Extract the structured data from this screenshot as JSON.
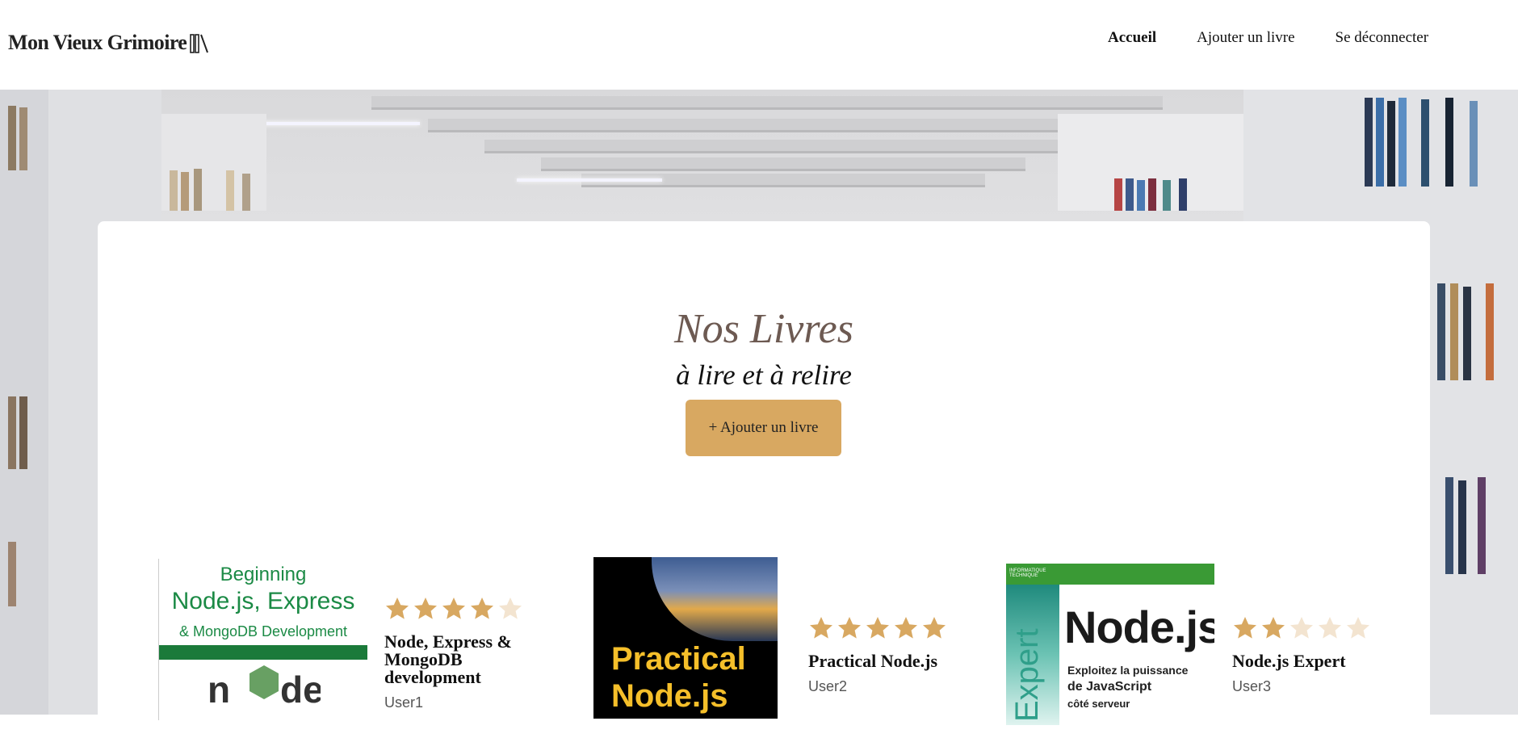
{
  "header": {
    "logo_text": "Mon Vieux Grimoire",
    "nav": [
      {
        "label": "Accueil",
        "active": true
      },
      {
        "label": "Ajouter un livre",
        "active": false
      },
      {
        "label": "Se déconnecter",
        "active": false
      }
    ]
  },
  "main": {
    "title": "Nos Livres",
    "subtitle": "à lire et à relire",
    "add_button": "+ Ajouter un livre"
  },
  "books": [
    {
      "title": "Node, Express & MongoDB development",
      "author": "User1",
      "year": "",
      "rating": 4,
      "cover": {
        "line1": "Beginning",
        "line2": "Node.js, Express",
        "line3": "& MongoDB Development",
        "logo": "node"
      }
    },
    {
      "title": "Practical Node.js",
      "author": "User2",
      "year": "",
      "rating": 5,
      "cover": {
        "line1": "Practical",
        "line2": "Node.js"
      }
    },
    {
      "title": "Node.js Expert",
      "author": "User3",
      "year": "",
      "rating": 2,
      "cover": {
        "brand": "INFORMATIQUE TECHNIQUE",
        "line1": "Node.js",
        "line2": "Exploitez la puissance",
        "line3": "de JavaScript",
        "line4": "côté serveur",
        "side": "Expert"
      }
    }
  ],
  "colors": {
    "accent": "#d8a861",
    "star_filled": "#d8a861",
    "star_empty": "#f3e4d0",
    "title": "#6d5a52"
  }
}
